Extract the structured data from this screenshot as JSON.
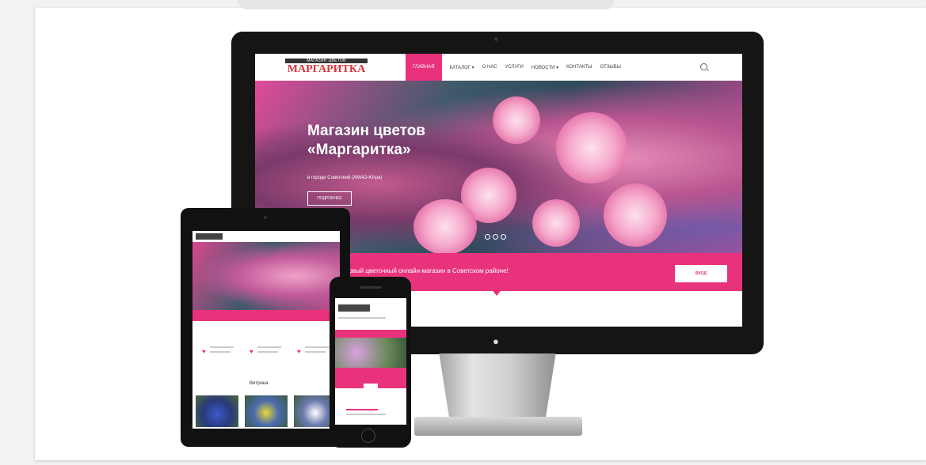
{
  "site": {
    "logo_top": "МАГАЗИН ЦВЕТОВ",
    "logo_main": "МАРГАРИТКА",
    "nav": [
      "ГЛАВНАЯ",
      "КАТАЛОГ ▾",
      "О НАС",
      "УСЛУГИ",
      "НОВОСТИ ▾",
      "КОНТАКТЫ",
      "ОТЗЫВЫ"
    ],
    "hero_title_line1": "Магазин цветов",
    "hero_title_line2": "«Маргаритка»",
    "hero_subtitle": "в городе Советский (ХМАО-Югра)",
    "hero_button": "ПОДРОБНЕЕ",
    "banner_text": "Первый цветочный онлайн-магазин в Советском районе!",
    "banner_button": "ВХОД"
  },
  "tablet": {
    "section_title": "Витрина"
  },
  "colors": {
    "accent": "#e8337c",
    "logo_red": "#d8343b",
    "device_frame": "#151515"
  }
}
